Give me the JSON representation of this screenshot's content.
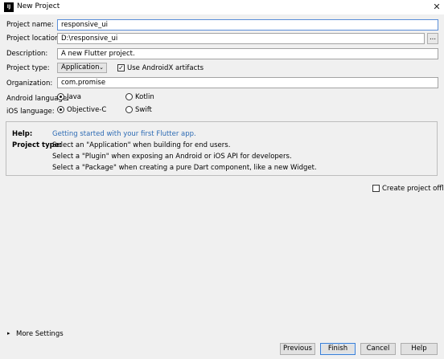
{
  "window": {
    "title": "New Project",
    "icon_text": "IJ",
    "close_glyph": "✕"
  },
  "form": {
    "project_name": {
      "label": "Project name:",
      "value": "responsive_ui"
    },
    "project_location": {
      "label": "Project location:",
      "value": "D:\\responsive_ui",
      "browse": "..."
    },
    "description": {
      "label": "Description:",
      "value": "A new Flutter project."
    },
    "project_type": {
      "label": "Project type:",
      "value": "Application",
      "androidx_label": "Use AndroidX artifacts",
      "androidx_checked": true
    },
    "organization": {
      "label": "Organization:",
      "value": "com.promise"
    },
    "android_language": {
      "label": "Android language:",
      "option1": "Java",
      "option2": "Kotlin",
      "selected": "Java"
    },
    "ios_language": {
      "label": "iOS language:",
      "option1": "Objective-C",
      "option2": "Swift",
      "selected": "Objective-C"
    }
  },
  "help": {
    "help_label": "Help:",
    "help_link": "Getting started with your first Flutter app.",
    "type_label": "Project type:",
    "lines": [
      "Select an \"Application\" when building for end users.",
      "Select a \"Plugin\" when exposing an Android or iOS API for developers.",
      "Select a \"Package\" when creating a pure Dart component, like a new Widget."
    ]
  },
  "create_offline": {
    "label": "Create project offline",
    "checked": false
  },
  "more_settings": "More Settings",
  "buttons": {
    "previous": "Previous",
    "finish": "Finish",
    "cancel": "Cancel",
    "help": "Help"
  }
}
